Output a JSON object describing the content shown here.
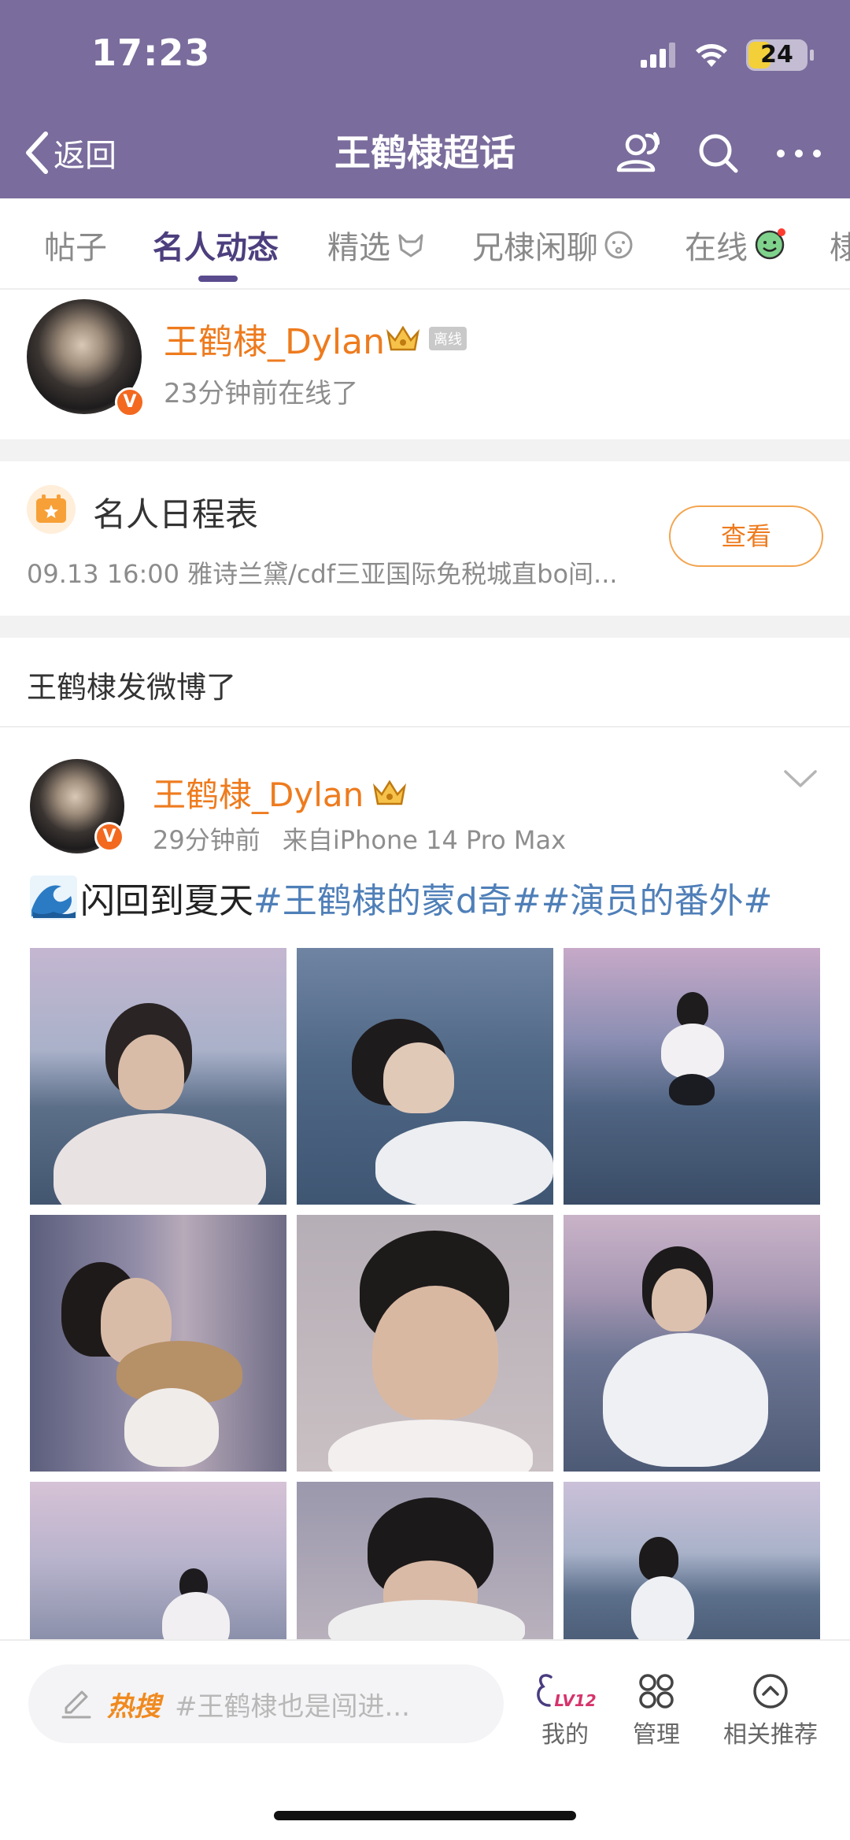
{
  "status_bar": {
    "time": "17:23",
    "battery": "24"
  },
  "nav": {
    "back_label": "返回",
    "title": "王鹤棣超话"
  },
  "tabs": [
    {
      "label": "帖子"
    },
    {
      "label": "名人动态"
    },
    {
      "label": "精选"
    },
    {
      "label": "兄棣闲聊"
    },
    {
      "label": "在线"
    },
    {
      "label": "棣"
    }
  ],
  "online_card": {
    "name": "王鹤棣_Dylan",
    "offline_tag": "离线",
    "status": "23分钟前在线了"
  },
  "schedule": {
    "title": "名人日程表",
    "item": "09.13 16:00 雅诗兰黛/cdf三亚国际免税城直bo间...",
    "button": "查看"
  },
  "section_title": "王鹤棣发微博了",
  "post": {
    "name": "王鹤棣_Dylan",
    "time": "29分钟前",
    "source": "来自iPhone 14 Pro Max",
    "text": "闪回到夏天",
    "hashtags": [
      "#王鹤棣的蒙d奇#",
      "#演员的番外#"
    ]
  },
  "bottom_bar": {
    "hot_label": "热搜",
    "search_query": "#王鹤棣也是闯进...",
    "level": "LV12",
    "my_label": "我的",
    "manage_label": "管理",
    "related_label": "相关推荐"
  },
  "colors": {
    "header_bg": "#7a6c9c",
    "accent_orange": "#ee7b1e",
    "tab_active": "#4d3f7e",
    "hashtag_blue": "#4f7fb8"
  }
}
